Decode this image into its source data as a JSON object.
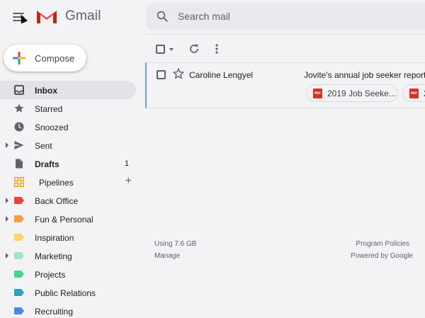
{
  "header": {
    "app_name": "Gmail",
    "search_placeholder": "Search mail"
  },
  "compose": {
    "label": "Compose"
  },
  "sidebar": {
    "items": [
      {
        "label": "Inbox",
        "icon": "inbox-icon",
        "active": true,
        "bold": true
      },
      {
        "label": "Starred",
        "icon": "star-icon"
      },
      {
        "label": "Snoozed",
        "icon": "clock-icon"
      },
      {
        "label": "Sent",
        "icon": "send-icon",
        "expandable": true
      },
      {
        "label": "Drafts",
        "icon": "draft-icon",
        "bold": true,
        "count": "1"
      },
      {
        "label": "Pipelines",
        "icon": "grid-icon",
        "action": "+"
      },
      {
        "label": "Back Office",
        "icon": "label-icon",
        "color": "#e8453c",
        "expandable": true
      },
      {
        "label": "Fun & Personal",
        "icon": "label-icon",
        "color": "#f2a03c",
        "expandable": true
      },
      {
        "label": "Inspiration",
        "icon": "label-icon",
        "color": "#fbd75b"
      },
      {
        "label": "Marketing",
        "icon": "label-icon",
        "color": "#a4e3c5",
        "expandable": true
      },
      {
        "label": "Projects",
        "icon": "label-icon",
        "color": "#42d692"
      },
      {
        "label": "Public Relations",
        "icon": "label-icon",
        "color": "#2da2bb"
      },
      {
        "label": "Recruiting",
        "icon": "label-icon",
        "color": "#4a86e8"
      }
    ]
  },
  "email": {
    "sender": "Caroline Lengyel",
    "subject": "Jovite's annual job seeker report",
    "attachments": [
      "2019 Job Seeke...",
      "2"
    ],
    "attachment_icon_text": "PDF"
  },
  "footer": {
    "storage": "Using 7.6 GB",
    "manage": "Manage",
    "policies": "Program Policies",
    "powered": "Powered by Google"
  },
  "colors": {
    "background": "#f3f2f4",
    "active_item": "#e3e2e6",
    "selected_row_bar": "#6a9fd8",
    "pdf_red": "#d93025"
  }
}
